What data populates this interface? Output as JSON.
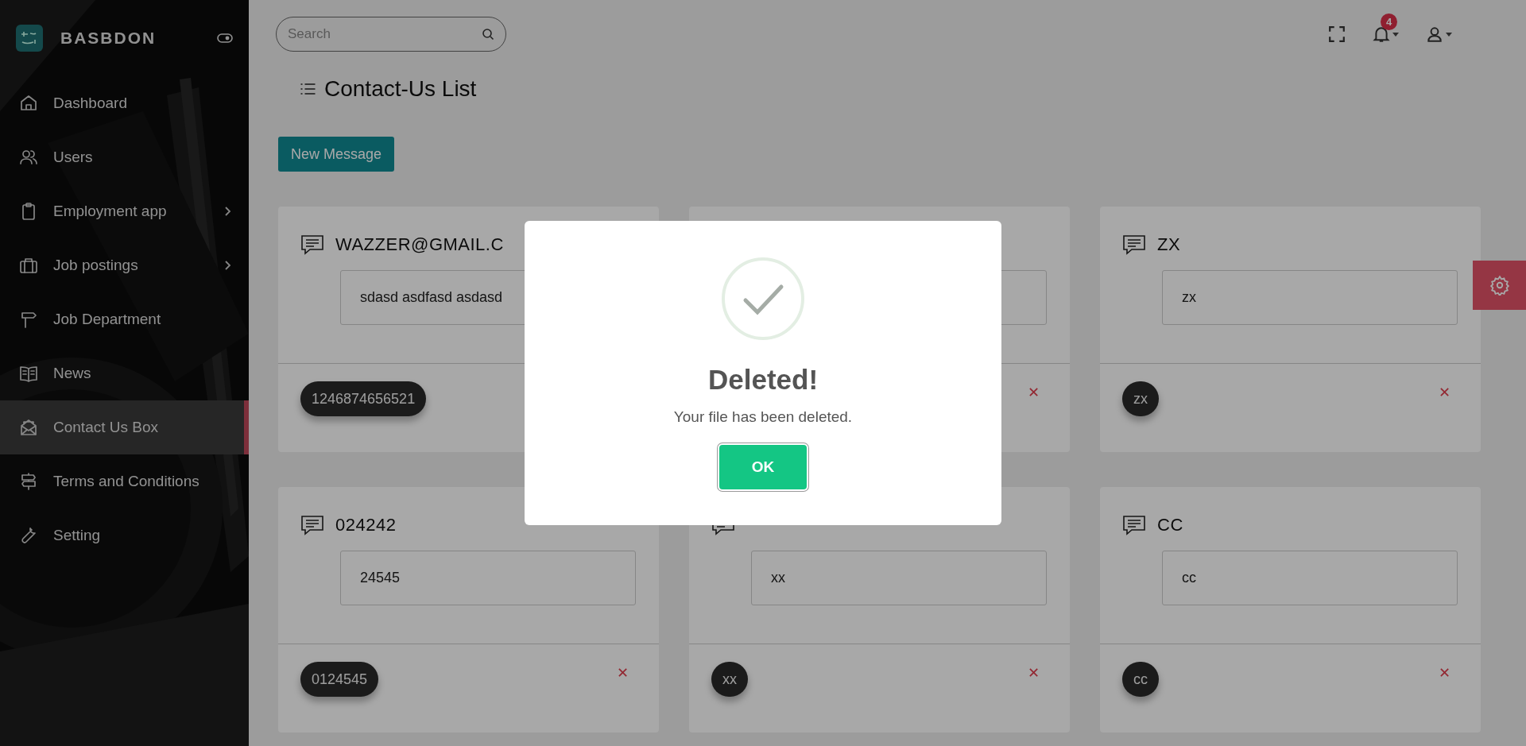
{
  "brand": {
    "name": "BASBDON"
  },
  "sidebar": {
    "items": [
      {
        "label": "Dashboard",
        "selected": false,
        "has_submenu": false
      },
      {
        "label": "Users",
        "selected": false,
        "has_submenu": false
      },
      {
        "label": "Employment app",
        "selected": false,
        "has_submenu": true
      },
      {
        "label": "Job postings",
        "selected": false,
        "has_submenu": true
      },
      {
        "label": "Job Department",
        "selected": false,
        "has_submenu": false
      },
      {
        "label": "News",
        "selected": false,
        "has_submenu": false
      },
      {
        "label": "Contact Us Box",
        "selected": true,
        "has_submenu": false
      },
      {
        "label": "Terms and Conditions",
        "selected": false,
        "has_submenu": false
      },
      {
        "label": "Setting",
        "selected": false,
        "has_submenu": false
      }
    ]
  },
  "search": {
    "placeholder": "Search"
  },
  "notifications": {
    "count": "4"
  },
  "page_title": "Contact-Us List",
  "new_button": "New Message",
  "cards": [
    {
      "title": "WAZZER@GMAIL.C",
      "message": "sdasd asdfasd asdasd",
      "sender": "1246874656521"
    },
    {
      "delete": "✕"
    },
    {
      "title": "ZX",
      "message": "zx",
      "sender": "zx",
      "delete": "✕"
    },
    {
      "title": "024242",
      "message": "24545",
      "sender": "0124545",
      "delete": "✕"
    },
    {
      "message": "xx",
      "sender": "xx",
      "delete": "✕"
    },
    {
      "title": "CC",
      "message": "cc",
      "sender": "cc",
      "delete": "✕"
    }
  ],
  "dialog": {
    "title": "Deleted!",
    "text": "Your file has been deleted.",
    "button": "OK"
  }
}
